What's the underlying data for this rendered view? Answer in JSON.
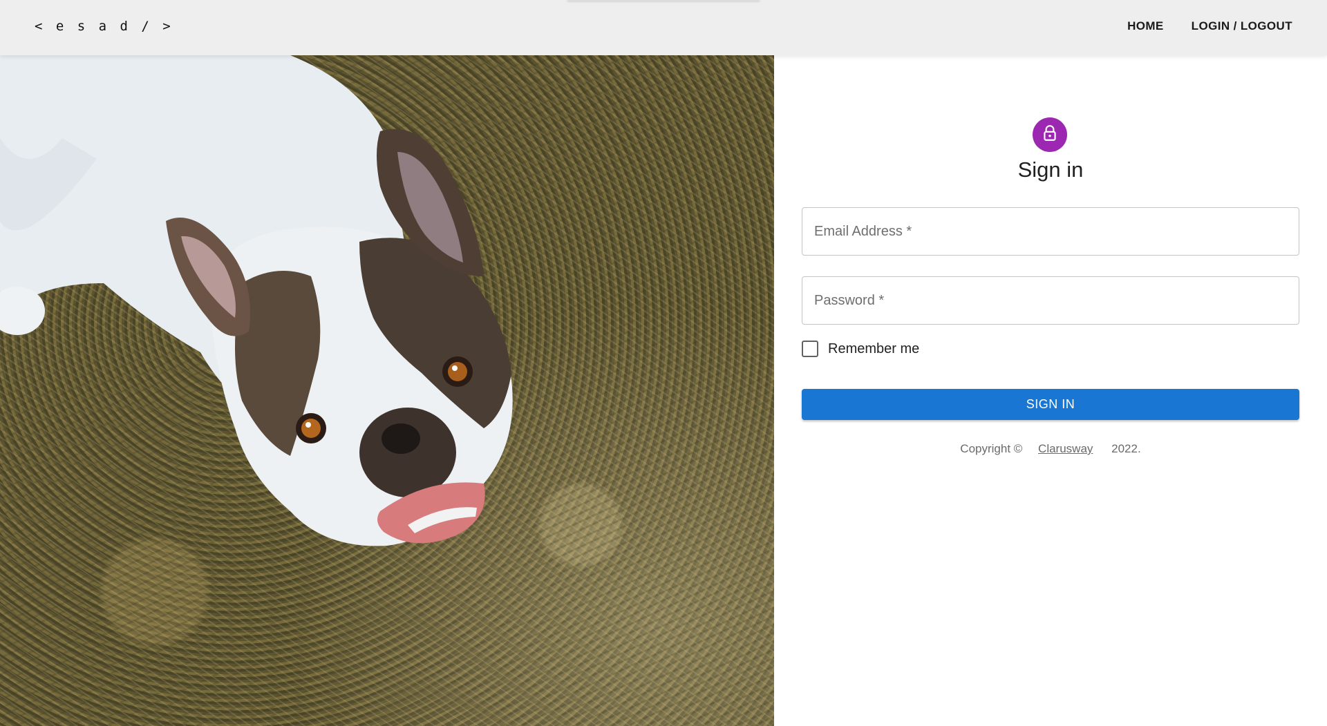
{
  "navbar": {
    "brand": "< e s a d / >",
    "links": [
      {
        "label": "HOME"
      },
      {
        "label": "LOGIN / LOGOUT"
      }
    ]
  },
  "hero": {
    "icon": "french-bulldog-photo"
  },
  "signin": {
    "avatar_icon": "lock-icon",
    "avatar_color": "#9c27b0",
    "title": "Sign in",
    "email_placeholder": "Email Address *",
    "email_value": "",
    "password_placeholder": "Password *",
    "password_value": "",
    "remember_label": "Remember me",
    "remember_checked": false,
    "button_label": "SIGN IN",
    "button_color": "#1976d2",
    "copyright_prefix": "Copyright ©",
    "copyright_link": "Clarusway",
    "copyright_year": "2022."
  }
}
